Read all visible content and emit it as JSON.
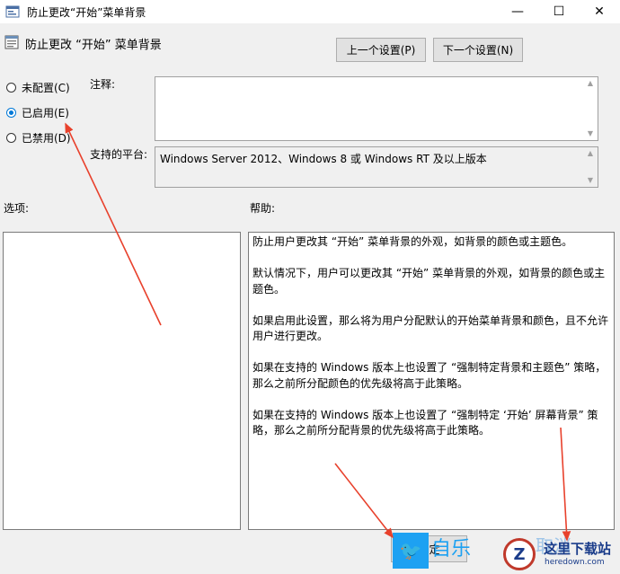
{
  "window": {
    "title": "防止更改“开始”菜单背景",
    "minimize_glyph": "—",
    "maximize_glyph": "☐",
    "close_glyph": "✕"
  },
  "header": {
    "policy_title": "防止更改 “开始” 菜单背景",
    "prev_label": "上一个设置(P)",
    "next_label": "下一个设置(N)"
  },
  "state": {
    "options": [
      {
        "label": "未配置(C)",
        "checked": false
      },
      {
        "label": "已启用(E)",
        "checked": true
      },
      {
        "label": "已禁用(D)",
        "checked": false
      }
    ]
  },
  "comment": {
    "label": "注释:",
    "value": ""
  },
  "platform": {
    "label": "支持的平台:",
    "value": "Windows Server 2012、Windows 8 或 Windows RT 及以上版本"
  },
  "options_label": "选项:",
  "help": {
    "label": "帮助:",
    "paragraphs": [
      "防止用户更改其 “开始” 菜单背景的外观，如背景的颜色或主题色。",
      "默认情况下，用户可以更改其 “开始” 菜单背景的外观，如背景的颜色或主题色。",
      "如果启用此设置，那么将为用户分配默认的开始菜单背景和颜色，且不允许用户进行更改。",
      "如果在支持的 Windows 版本上也设置了 “强制特定背景和主题色” 策略，那么之前所分配颜色的优先级将高于此策略。",
      "如果在支持的 Windows 版本上也设置了 “强制特定 ‘开始’ 屏幕背景” 策略，那么之前所分配背景的优先级将高于此策略。"
    ]
  },
  "footer": {
    "ok_label": "确定",
    "cancel_label": "取消"
  },
  "watermark": {
    "text1": "自乐",
    "badge": "Z",
    "name": "这里下载站",
    "url": "heredown.com"
  },
  "colors": {
    "accent": "#0078d7",
    "arrow": "#e8412c"
  }
}
